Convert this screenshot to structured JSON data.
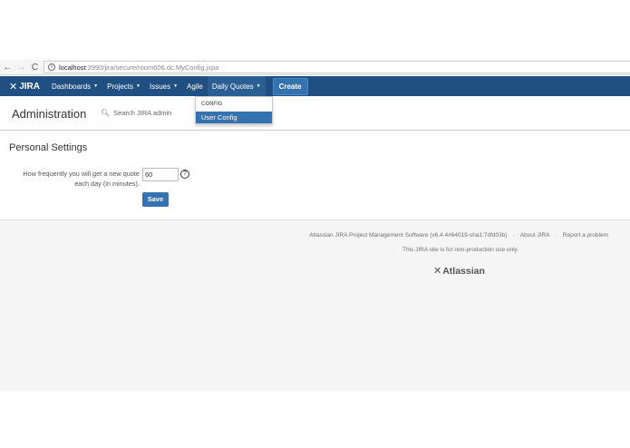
{
  "browser": {
    "back": "←",
    "forward": "→",
    "reload": "C",
    "url_host": "localhost",
    "url_path": ":2990/jira/secure/room606.dc.MyConfig.jspa"
  },
  "header": {
    "logo_text": "JIRA",
    "nav": [
      {
        "label": "Dashboards"
      },
      {
        "label": "Projects"
      },
      {
        "label": "Issues"
      },
      {
        "label": "Agile"
      },
      {
        "label": "Daily Quotes"
      }
    ],
    "create_label": "Create"
  },
  "dropdown": {
    "section": "CONFIG",
    "item": "User Config"
  },
  "admin": {
    "title": "Administration",
    "search_label": "Search JIRA admin"
  },
  "main": {
    "heading": "Personal Settings",
    "field_label": "How frequently you will get a new quote each day (in minutes).",
    "field_value": "60",
    "help": "?",
    "save_label": "Save"
  },
  "footer": {
    "version": "Atlassian JIRA Project Management Software (v6.4.4#64019-sha1:7dfd03b)",
    "about": "About JIRA",
    "report": "Report a problem",
    "note": "This JIRA site is for non-production use only.",
    "logo": "Atlassian"
  },
  "colors": {
    "header_bg": "#205081",
    "accent": "#3572b0"
  }
}
